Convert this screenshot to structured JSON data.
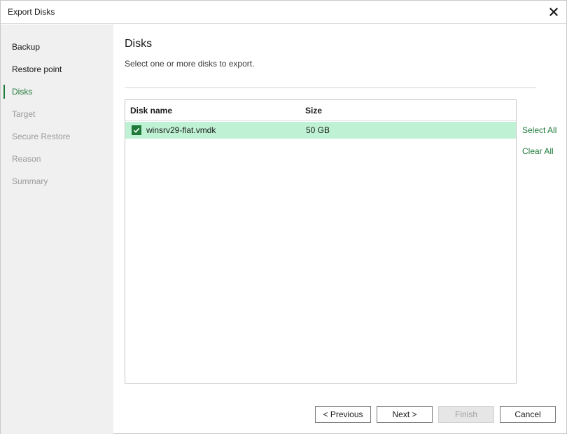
{
  "window": {
    "title": "Export Disks",
    "close_icon": "close-icon"
  },
  "sidebar": {
    "items": [
      {
        "label": "Backup",
        "state": "done"
      },
      {
        "label": "Restore point",
        "state": "done"
      },
      {
        "label": "Disks",
        "state": "active"
      },
      {
        "label": "Target",
        "state": "pending"
      },
      {
        "label": "Secure Restore",
        "state": "pending"
      },
      {
        "label": "Reason",
        "state": "pending"
      },
      {
        "label": "Summary",
        "state": "pending"
      }
    ]
  },
  "main": {
    "heading": "Disks",
    "description": "Select one or more disks to export.",
    "table": {
      "columns": [
        "Disk name",
        "Size"
      ],
      "rows": [
        {
          "name": "winsrv29-flat.vmdk",
          "size": "50 GB",
          "checked": true
        }
      ]
    },
    "select_all_label": "Select All",
    "clear_all_label": "Clear All"
  },
  "footer": {
    "previous_label": "< Previous",
    "next_label": "Next >",
    "finish_label": "Finish",
    "cancel_label": "Cancel"
  },
  "colors": {
    "accent": "#1f7a3a",
    "selected_row": "#bff2d4",
    "sidebar_bg": "#f0f0f0"
  }
}
